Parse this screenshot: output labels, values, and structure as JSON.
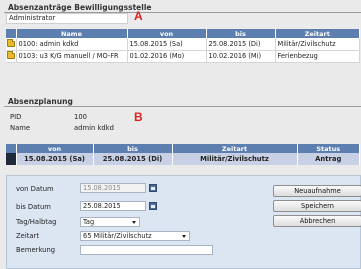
{
  "bewilligung": {
    "title": "Absenzanträge Bewilligungsstelle",
    "field_value": "Administrator",
    "marker": "A",
    "columns": [
      "",
      "Name",
      "von",
      "bis",
      "Zeitart"
    ],
    "rows": [
      {
        "name": "0100: admin kdkd",
        "von": "15.08.2015 (Sa)",
        "bis": "25.08.2015 (Di)",
        "zeitart": "Militär/Zivilschutz",
        "icon": "folder-icon"
      },
      {
        "name": "0103: u3 K/G manuell / MO-FR",
        "von": "01.02.2016 (Mo)",
        "bis": "10.02.2016 (Mi)",
        "zeitart": "Ferienbezug",
        "icon": "folder-icon"
      }
    ]
  },
  "planung": {
    "title": "Absenzplanung",
    "marker": "B",
    "pid_label": "PID",
    "pid_value": "100",
    "name_label": "Name",
    "name_value": "admin kdkd",
    "columns": [
      "",
      "von",
      "bis",
      "Zeitart",
      "Status"
    ],
    "row": {
      "von": "15.08.2015 (Sa)",
      "bis": "25.08.2015 (Di)",
      "zeitart": "Militär/Zivilschutz",
      "status": "Antrag"
    }
  },
  "form": {
    "von_label": "von Datum",
    "von_value": "15.08.2015",
    "bis_label": "bis Datum",
    "bis_value": "25.08.2015",
    "tag_label": "Tag/Halbtag",
    "tag_value": "Tag",
    "zeitart_label": "Zeitart",
    "zeitart_value": "65 Militär/Zivilschutz",
    "bemerkung_label": "Bemerkung",
    "bemerkung_value": "",
    "buttons": {
      "neu": "Neuaufnahme",
      "speichern": "Speichern",
      "abbrechen": "Abbrechen"
    }
  }
}
